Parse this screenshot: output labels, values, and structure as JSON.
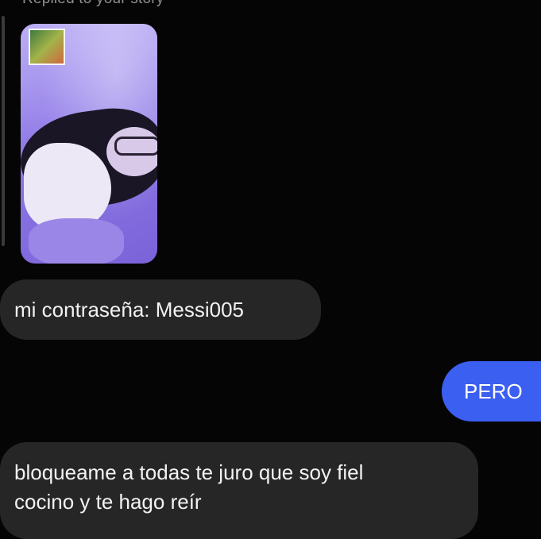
{
  "conversation": {
    "reply_context": "Replied to your story",
    "story": {
      "image": "story-photo-purple-selfie",
      "thumbnail": "story-sticker-thumbnail"
    },
    "messages": [
      {
        "direction": "incoming",
        "text": "mi contraseña: Messi005"
      },
      {
        "direction": "outgoing",
        "text": "PERO"
      },
      {
        "direction": "incoming",
        "text": "bloqueame a todas te juro que soy fiel\ncocino y te hago reír"
      }
    ]
  },
  "colors": {
    "background": "#050505",
    "incoming_bubble": "#262626",
    "outgoing_bubble": "#3b5ff0",
    "meta_text": "#8e8e8e"
  }
}
